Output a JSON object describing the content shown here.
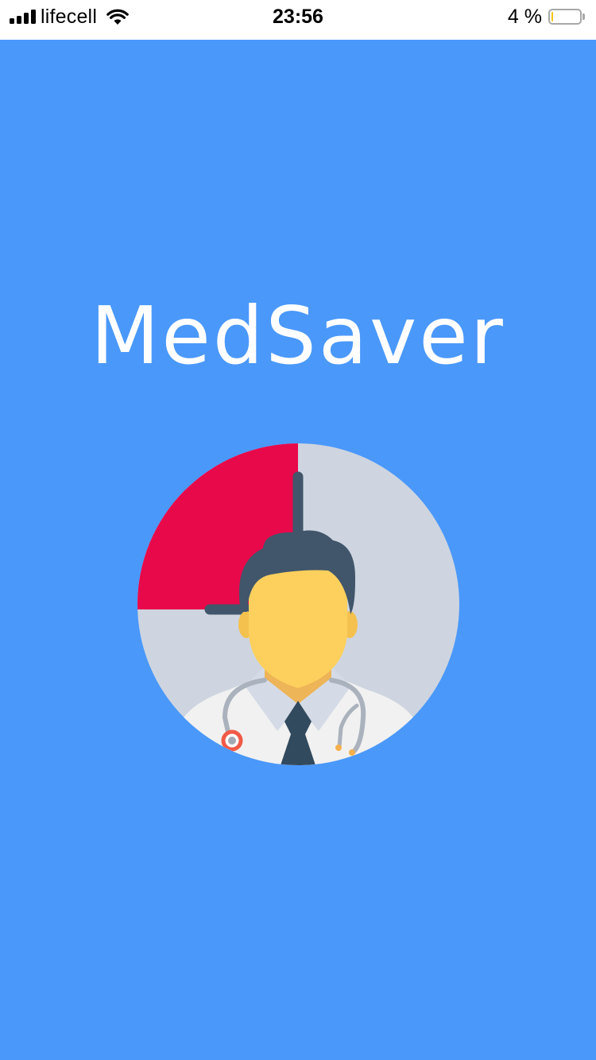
{
  "status_bar": {
    "carrier": "lifecell",
    "time": "23:56",
    "battery_percent": "4 %",
    "icons": [
      "signal-icon",
      "wifi-icon",
      "battery-icon"
    ]
  },
  "app": {
    "title": "MedSaver"
  },
  "logo": {
    "icon": "doctor-clock-logo"
  },
  "colors": {
    "background": "#4a98fa",
    "title_text": "#ffffff",
    "clock_face": "#ced5e0",
    "clock_sector": "#e8094b",
    "hair": "#41566b",
    "skin": "#fdd05d",
    "coat": "#f1f1f1",
    "tie": "#324a5e"
  }
}
